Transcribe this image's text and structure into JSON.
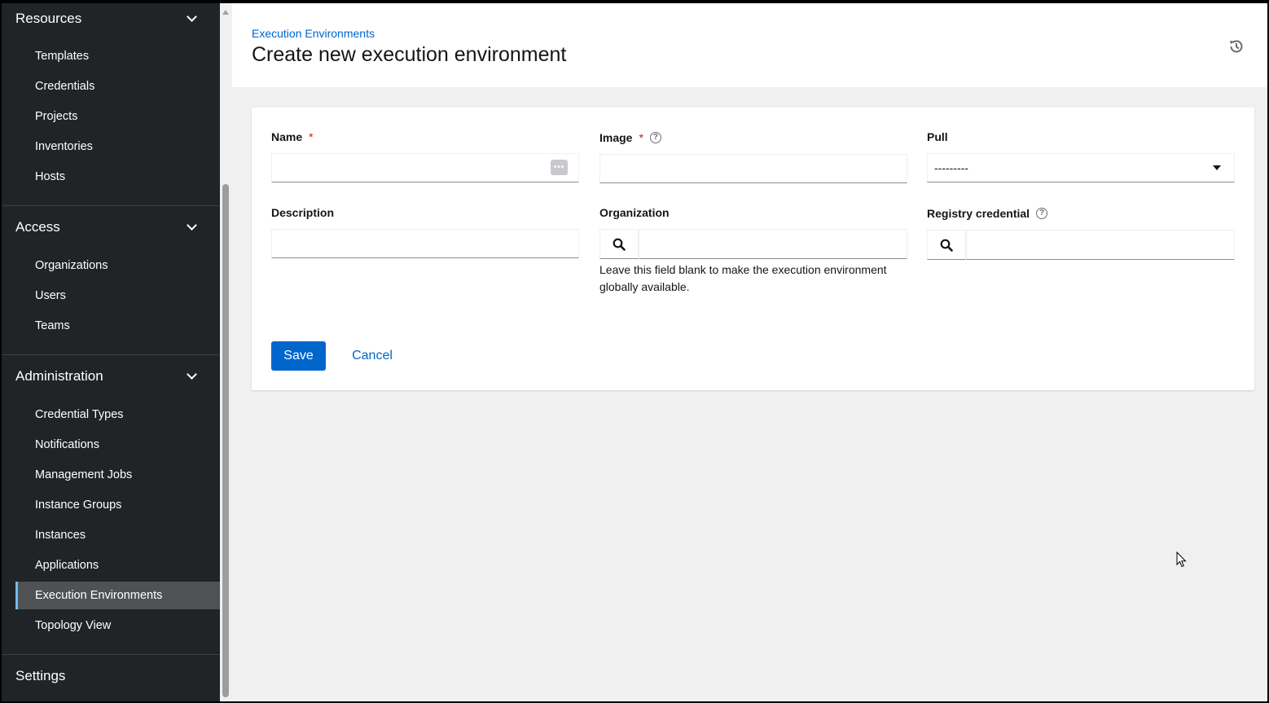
{
  "sidebar": {
    "groups": [
      {
        "label": "Resources",
        "items": [
          "Templates",
          "Credentials",
          "Projects",
          "Inventories",
          "Hosts"
        ]
      },
      {
        "label": "Access",
        "items": [
          "Organizations",
          "Users",
          "Teams"
        ]
      },
      {
        "label": "Administration",
        "items": [
          "Credential Types",
          "Notifications",
          "Management Jobs",
          "Instance Groups",
          "Instances",
          "Applications",
          "Execution Environments",
          "Topology View"
        ]
      },
      {
        "label": "Settings",
        "items": []
      }
    ],
    "active_item": "Execution Environments"
  },
  "header": {
    "breadcrumb": "Execution Environments",
    "title": "Create new execution environment"
  },
  "form": {
    "name": {
      "label": "Name",
      "required": "*",
      "value": ""
    },
    "image": {
      "label": "Image",
      "required": "*",
      "help": "?",
      "value": ""
    },
    "pull": {
      "label": "Pull",
      "selected": "---------"
    },
    "description": {
      "label": "Description",
      "value": ""
    },
    "organization": {
      "label": "Organization",
      "helper": "Leave this field blank to make the execution environment globally available."
    },
    "registry_credential": {
      "label": "Registry credential",
      "help": "?"
    },
    "keyboard_icon_text": "•••"
  },
  "actions": {
    "save": "Save",
    "cancel": "Cancel"
  },
  "colors": {
    "sidebar_bg": "#212427",
    "primary": "#0066cc",
    "required": "#c9190b",
    "active_border": "#73bcf7"
  }
}
